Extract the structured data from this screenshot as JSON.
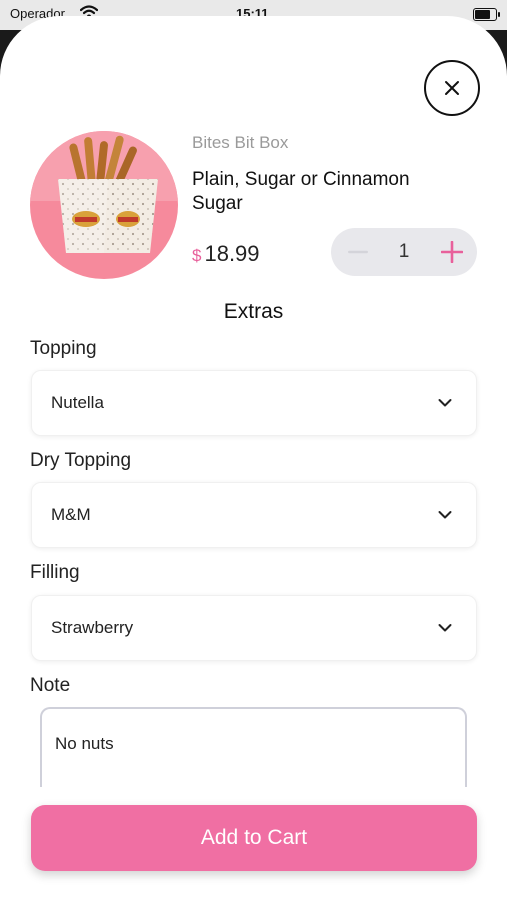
{
  "status_bar": {
    "carrier": "Operador",
    "time": "15:11"
  },
  "product": {
    "brand": "Bites Bit Box",
    "name": "Plain, Sugar or Cinnamon Sugar",
    "currency_symbol": "$",
    "price": "18.99",
    "quantity": "1",
    "image_logo_text": "Churros"
  },
  "extras": {
    "title": "Extras",
    "topping": {
      "label": "Topping",
      "value": "Nutella"
    },
    "dry_topping": {
      "label": "Dry Topping",
      "value": "M&M"
    },
    "filling": {
      "label": "Filling",
      "value": "Strawberry"
    },
    "note": {
      "label": "Note",
      "value": "No nuts"
    }
  },
  "actions": {
    "add_to_cart": "Add to Cart"
  },
  "colors": {
    "accent": "#f06fa3",
    "price_symbol": "#e8609b",
    "stepper_bg": "#e8e8ec"
  },
  "icons": {
    "close": "close-icon",
    "chevron": "chevron-down-icon",
    "minus": "minus-icon",
    "plus": "plus-icon"
  }
}
